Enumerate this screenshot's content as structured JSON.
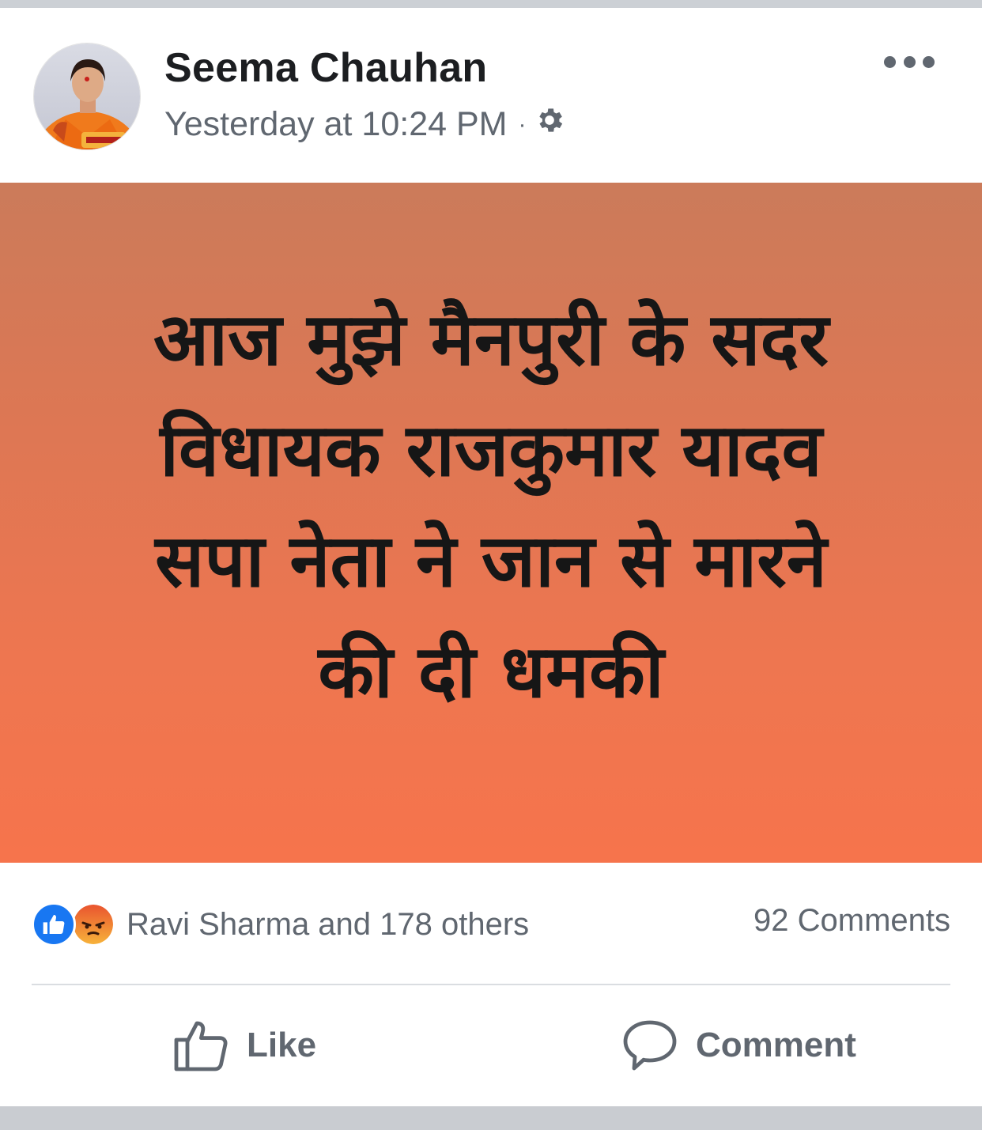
{
  "post": {
    "author": "Seema Chauhan",
    "timestamp": "Yesterday at 10:24 PM",
    "separator": "·",
    "privacy_icon": "gear-icon",
    "more_icon": "more-options-icon",
    "text_lines": [
      "आज मुझे मैनपुरी के सदर",
      "विधायक राजकुमार यादव",
      "सपा नेता ने जान से मारने",
      "की दी धमकी"
    ],
    "background_colors": [
      "#cb7b5a",
      "#f6744c"
    ]
  },
  "reactions": {
    "icons": [
      "like-reaction-icon",
      "angry-reaction-icon"
    ],
    "summary": "Ravi Sharma and 178 others",
    "comments": "92 Comments"
  },
  "actions": {
    "like_label": "Like",
    "comment_label": "Comment"
  },
  "colors": {
    "like_blue": "#1877f2",
    "secondary_text": "#606770",
    "primary_text": "#1c1e21"
  }
}
